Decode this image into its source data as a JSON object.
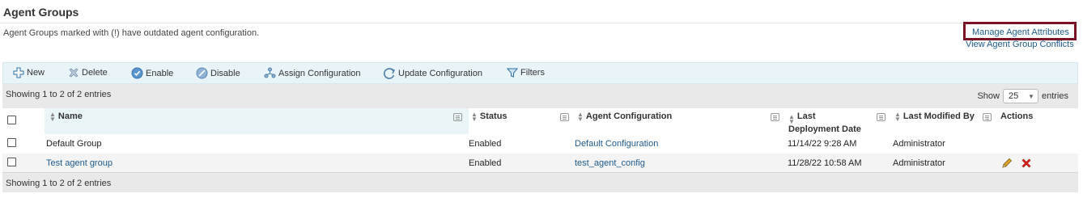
{
  "page": {
    "title": "Agent Groups",
    "subtitle": "Agent Groups marked with (!) have outdated agent configuration."
  },
  "links": {
    "manage_attributes": "Manage Agent Attributes",
    "view_conflicts": "View Agent Group Conflicts"
  },
  "toolbar": {
    "new": "New",
    "delete": "Delete",
    "enable": "Enable",
    "disable": "Disable",
    "assign": "Assign Configuration",
    "update": "Update Configuration",
    "filters": "Filters"
  },
  "info": {
    "top": "Showing 1 to 2 of 2 entries",
    "bottom": "Showing 1 to 2 of 2 entries",
    "show_label": "Show",
    "page_size": "25",
    "entries_label": "entries"
  },
  "table": {
    "columns": {
      "name": "Name",
      "status": "Status",
      "agent_config": "Agent Configuration",
      "last_deploy_1": "Last",
      "last_deploy_2": "Deployment Date",
      "last_modified": "Last Modified By",
      "actions": "Actions"
    },
    "rows": [
      {
        "name": "Default Group",
        "status": "Enabled",
        "config": "Default Configuration",
        "deployed": "11/14/22 9:28 AM",
        "modified_by": "Administrator"
      },
      {
        "name": "Test agent group",
        "status": "Enabled",
        "config": "test_agent_config",
        "deployed": "11/28/22 10:58 AM",
        "modified_by": "Administrator"
      }
    ]
  },
  "colors": {
    "link": "#1e5a8c",
    "highlight_box": "#7a1226",
    "toolbar_bg": "#e8f4f8",
    "delete_red": "#d9231c"
  }
}
